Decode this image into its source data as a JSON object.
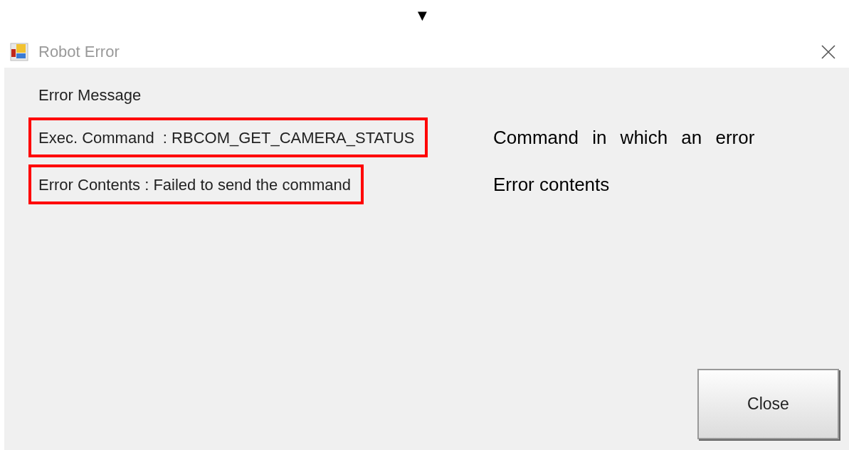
{
  "marker": "▼",
  "window": {
    "title": "Robot Error"
  },
  "heading": "Error Message",
  "fields": [
    {
      "text": "Exec. Command  : RBCOM_GET_CAMERA_STATUS",
      "highlighted": true,
      "note": "Command in which an error"
    },
    {
      "text": "Error Contents : Failed to send the command",
      "highlighted": true,
      "note": "Error contents"
    }
  ],
  "buttons": [
    "Close"
  ]
}
